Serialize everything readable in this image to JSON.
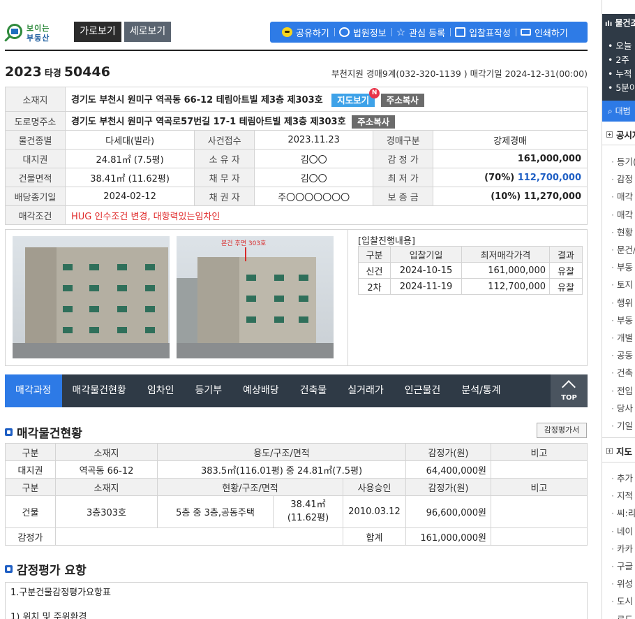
{
  "logo": {
    "line1": "보이는",
    "line2": "부동산"
  },
  "view_buttons": {
    "horizontal": "가로보기",
    "vertical": "세로보기"
  },
  "toolbar": {
    "share": "공유하기",
    "court_info": "법원정보",
    "favorite": "관심 등록",
    "bid_form": "입찰표작성",
    "print": "인쇄하기"
  },
  "case": {
    "year": "2023",
    "type": "타경",
    "number": "50446",
    "court_info": "부천지원 경매9계(032-320-1139 ) 매각기일 2024-12-31(00:00)"
  },
  "info": {
    "address_label": "소재지",
    "address": "경기도 부천시 원미구 역곡동 66-12 테림아트빌 제3층 제303호",
    "map_button": "지도보기",
    "new_badge": "N",
    "copy_button": "주소복사",
    "road_label": "도로명주소",
    "road_address": "경기도 부천시 원미구 역곡로57번길 17-1 테림아트빌 제3층 제303호",
    "rows": [
      {
        "l1": "물건종별",
        "v1": "다세대(빌라)",
        "l2": "사건접수",
        "v2": "2023.11.23",
        "l3": "경매구분",
        "v3": "강제경매"
      },
      {
        "l1": "대지권",
        "v1": "24.81㎡ (7.5평)",
        "l2": "소 유 자",
        "v2": "김〇〇",
        "l3": "감 정 가",
        "v3": "161,000,000"
      },
      {
        "l1": "건물면적",
        "v1": "38.41㎡ (11.62평)",
        "l2": "채 무 자",
        "v2": "김〇〇",
        "l3": "최 저 가",
        "v3a": "(70%)",
        "v3b": "112,700,000"
      },
      {
        "l1": "배당종기일",
        "v1": "2024-02-12",
        "l2": "채 권 자",
        "v2": "주〇〇〇〇〇〇〇",
        "l3": "보 증 금",
        "v3": "(10%) 11,270,000"
      }
    ],
    "condition_label": "매각조건",
    "condition": "HUG 인수조건 변경, 대항력있는임차인"
  },
  "photo_note": "본건 후면 303호",
  "bid": {
    "title": "[입찰진행내용]",
    "headers": [
      "구분",
      "입찰기일",
      "최저매각가격",
      "결과"
    ],
    "rows": [
      [
        "신건",
        "2024-10-15",
        "161,000,000",
        "유찰"
      ],
      [
        "2차",
        "2024-11-19",
        "112,700,000",
        "유찰"
      ]
    ]
  },
  "tabs": [
    "매각과정",
    "매각물건현황",
    "임차인",
    "등기부",
    "예상배당",
    "건축물",
    "실거래가",
    "인근물건",
    "분석/통계"
  ],
  "top_label": "TOP",
  "section1": {
    "title": "매각물건현황",
    "appraisal_button": "감정평가서",
    "h1": [
      "구분",
      "소재지",
      "용도/구조/면적",
      "감정가(원)",
      "비고"
    ],
    "land": [
      "대지권",
      "역곡동 66-12",
      "383.5㎡(116.01평) 중 24.81㎡(7.5평)",
      "64,400,000원",
      ""
    ],
    "h2": [
      "구분",
      "소재지",
      "현황/구조/면적",
      "사용승인",
      "감정가(원)",
      "비고"
    ],
    "building": {
      "type": "건물",
      "location": "3층303호",
      "structure": "5층 중 3층,공동주택",
      "area1": "38.41㎡",
      "area2": "(11.62평)",
      "approval": "2010.03.12",
      "price": "96,600,000원",
      "note": ""
    },
    "total": {
      "label": "감정가",
      "sum_label": "합계",
      "sum": "161,000,000원"
    }
  },
  "section2": {
    "title": "감정평가 요항",
    "line1": "1.구분건물감정평가요항표",
    "line2": "1) 위치 및 주위환경"
  },
  "right_panel": {
    "head": "물건조",
    "stats": [
      "오늘",
      "2주",
      "누적",
      "5분이"
    ],
    "blue_btn": "대법",
    "sec1": "공시자",
    "items1": [
      "등기(",
      "감정",
      "매각",
      "매각",
      "현황",
      "문건/",
      "부동",
      "토지",
      "행위",
      "부동",
      "개별",
      "공동",
      "건축",
      "전입",
      "당사",
      "기일"
    ],
    "sec2": "지도",
    "items2": [
      "추가",
      "지적",
      "씨:리",
      "네이",
      "카카",
      "구글",
      "위성",
      "도시",
      "로드"
    ]
  },
  "colors": {
    "accent": "#2d7ae6",
    "dark": "#2f3a46",
    "red": "#e02c2c",
    "link_blue": "#1f5fc4"
  }
}
